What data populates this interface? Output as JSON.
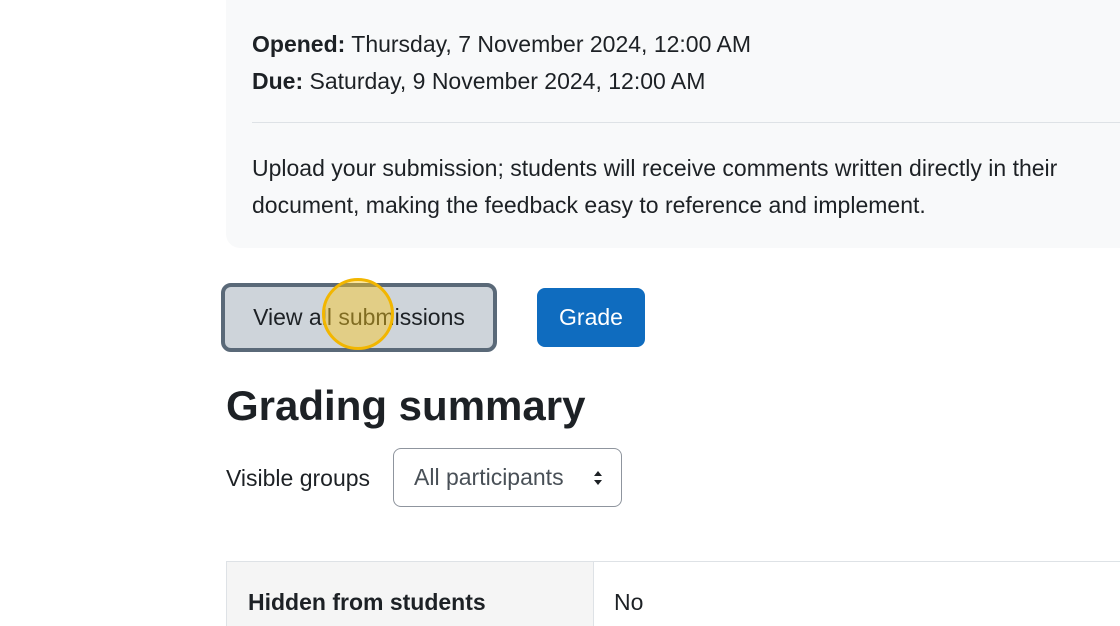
{
  "activity": {
    "opened_label": "Opened:",
    "opened_value": "Thursday, 7 November 2024, 12:00 AM",
    "due_label": "Due:",
    "due_value": "Saturday, 9 November 2024, 12:00 AM",
    "intro_line1": "Upload your submission; students will receive comments written directly in their",
    "intro_line2": "document, making the feedback easy to reference and implement."
  },
  "actions": {
    "view_all_label": "View all submissions",
    "grade_label": "Grade"
  },
  "grading_summary": {
    "heading": "Grading summary",
    "groups_label": "Visible groups",
    "groups_selected": "All participants",
    "rows": [
      {
        "label": "Hidden from students",
        "value": "No"
      }
    ]
  },
  "colors": {
    "primary": "#0f6cbf",
    "secondary": "#ced4da",
    "click_indicator": "#f2b600"
  },
  "icons": {
    "select_caret": "sort-caret-icon"
  }
}
